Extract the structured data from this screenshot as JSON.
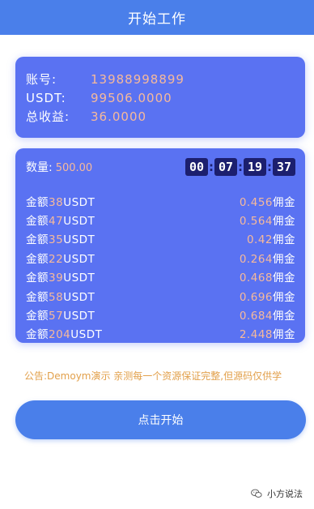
{
  "header": {
    "title": "开始工作"
  },
  "account": {
    "rows": [
      {
        "label": "账号:",
        "value": "13988998899"
      },
      {
        "label": "USDT:",
        "value": "99506.0000"
      },
      {
        "label": "总收益:",
        "value": "36.0000"
      }
    ]
  },
  "orders": {
    "quantity_label": "数量:",
    "quantity_value": "500.00",
    "timer": {
      "hours": "00",
      "minutes": "07",
      "seconds": "19",
      "ms": "37",
      "separator": ":"
    },
    "items": [
      {
        "prefix": "金额",
        "amount": "38",
        "unit": "USDT",
        "commission": "0.456",
        "suffix": "佣金"
      },
      {
        "prefix": "金额",
        "amount": "47",
        "unit": "USDT",
        "commission": "0.564",
        "suffix": "佣金"
      },
      {
        "prefix": "金额",
        "amount": "35",
        "unit": "USDT",
        "commission": "0.42",
        "suffix": "佣金"
      },
      {
        "prefix": "金额",
        "amount": "22",
        "unit": "USDT",
        "commission": "0.264",
        "suffix": "佣金"
      },
      {
        "prefix": "金额",
        "amount": "39",
        "unit": "USDT",
        "commission": "0.468",
        "suffix": "佣金"
      },
      {
        "prefix": "金额",
        "amount": "58",
        "unit": "USDT",
        "commission": "0.696",
        "suffix": "佣金"
      },
      {
        "prefix": "金额",
        "amount": "57",
        "unit": "USDT",
        "commission": "0.684",
        "suffix": "佣金"
      },
      {
        "prefix": "金额",
        "amount": "204",
        "unit": "USDT",
        "commission": "2.448",
        "suffix": "佣金"
      }
    ]
  },
  "notice": {
    "text": "公告:Demoym演示 亲测每一个资源保证完整,但源码仅供学"
  },
  "actions": {
    "start_label": "点击开始"
  },
  "watermark": {
    "icon": "wechat-icon",
    "text": "小方说法"
  },
  "colors": {
    "header": "#4a7fea",
    "card": "#5a72f2",
    "accent_value": "#f6b99b",
    "timer_bg": "#1c1f6e",
    "notice": "#e2a04b"
  }
}
